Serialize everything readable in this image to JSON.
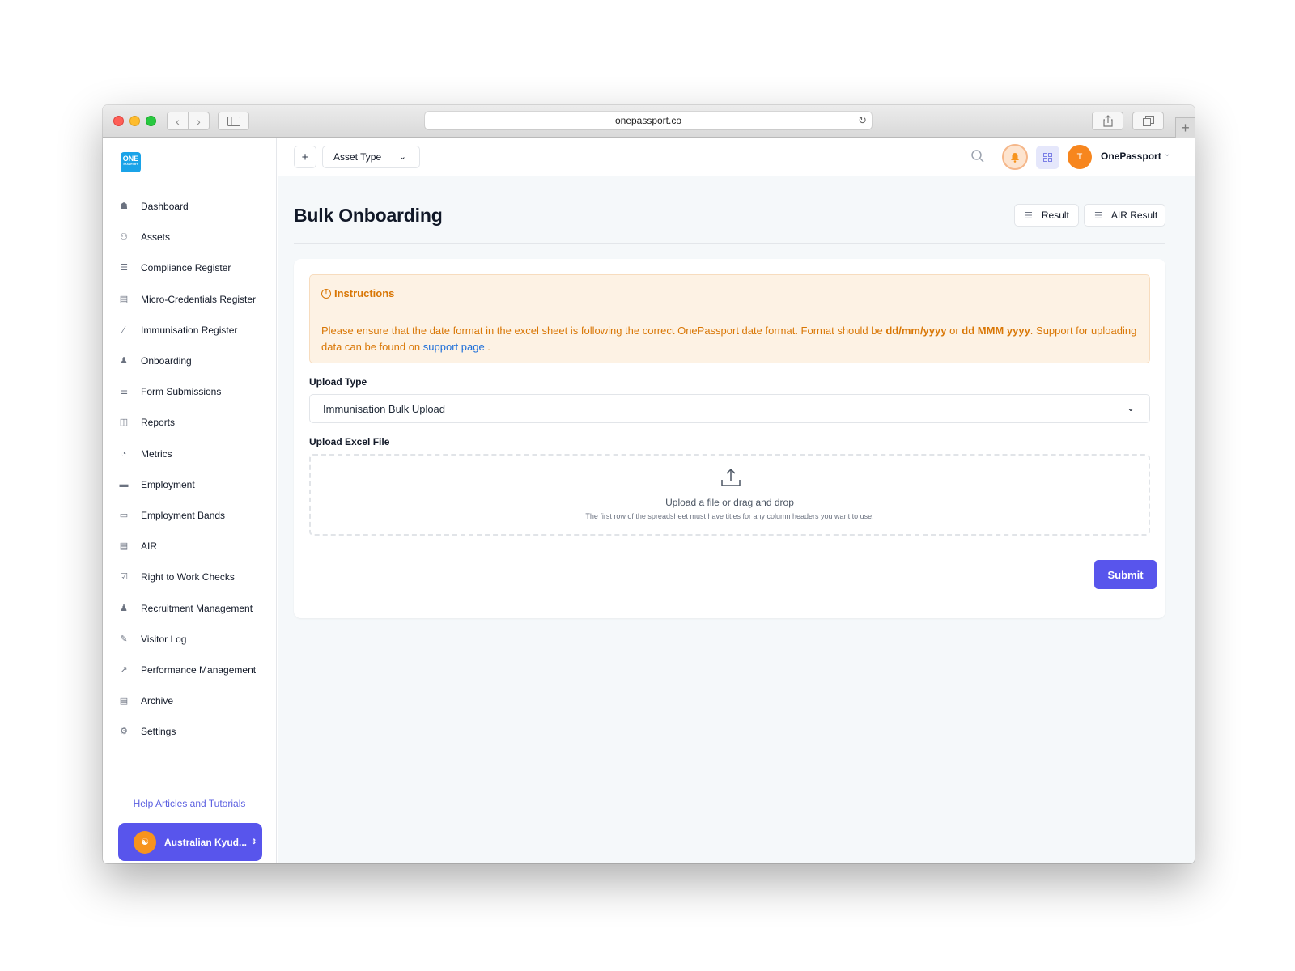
{
  "browser": {
    "url": "onepassport.co"
  },
  "sidebar": {
    "logo_text": "ONE",
    "logo_subtext": "PASSPORT",
    "items": [
      {
        "label": "Dashboard",
        "icon": "home-icon"
      },
      {
        "label": "Assets",
        "icon": "users-icon"
      },
      {
        "label": "Compliance Register",
        "icon": "list-icon"
      },
      {
        "label": "Micro-Credentials Register",
        "icon": "id-card-icon"
      },
      {
        "label": "Immunisation Register",
        "icon": "syringe-icon"
      },
      {
        "label": "Onboarding",
        "icon": "user-plus-icon"
      },
      {
        "label": "Form Submissions",
        "icon": "list-icon"
      },
      {
        "label": "Reports",
        "icon": "report-icon"
      },
      {
        "label": "Metrics",
        "icon": "pie-chart-icon"
      },
      {
        "label": "Employment",
        "icon": "briefcase-icon"
      },
      {
        "label": "Employment Bands",
        "icon": "band-icon"
      },
      {
        "label": "AIR",
        "icon": "document-icon"
      },
      {
        "label": "Right to Work Checks",
        "icon": "clipboard-check-icon"
      },
      {
        "label": "Recruitment Management",
        "icon": "team-icon"
      },
      {
        "label": "Visitor Log",
        "icon": "pen-icon"
      },
      {
        "label": "Performance Management",
        "icon": "trend-chart-icon"
      },
      {
        "label": "Archive",
        "icon": "archive-icon"
      },
      {
        "label": "Settings",
        "icon": "gear-icon"
      }
    ],
    "help_link": "Help Articles and Tutorials",
    "org_name": "Australian Kyud..."
  },
  "topbar": {
    "asset_type_label": "Asset Type",
    "user_initial": "T",
    "user_name": "OnePassport",
    "colors": {
      "bell": "#f7941d",
      "avatar": "#f7861e",
      "apps": "#7b7fe6"
    }
  },
  "page": {
    "title": "Bulk Onboarding",
    "result_button": "Result",
    "air_result_button": "AIR Result"
  },
  "instructions": {
    "heading": "Instructions",
    "text_1": "Please ensure that the date format in the excel sheet is following the correct OnePassport date format. Format should be ",
    "format_1": "dd/mm/yyyy",
    "text_or": " or ",
    "format_2": "dd MMM yyyy",
    "text_2": ". Support for uploading data can be found on ",
    "link_text": "support page",
    "text_end": " ."
  },
  "form": {
    "upload_type_label": "Upload Type",
    "upload_type_value": "Immunisation Bulk Upload",
    "upload_file_label": "Upload Excel File",
    "dropzone_main": "Upload a file or drag and drop",
    "dropzone_sub": "The first row of the spreadsheet must have titles for any column headers you want to use.",
    "submit_label": "Submit"
  },
  "colors": {
    "accent": "#5855ec",
    "warning_bg": "#fdf2e4",
    "warning_text": "#d97706",
    "link": "#1e6fd9"
  }
}
